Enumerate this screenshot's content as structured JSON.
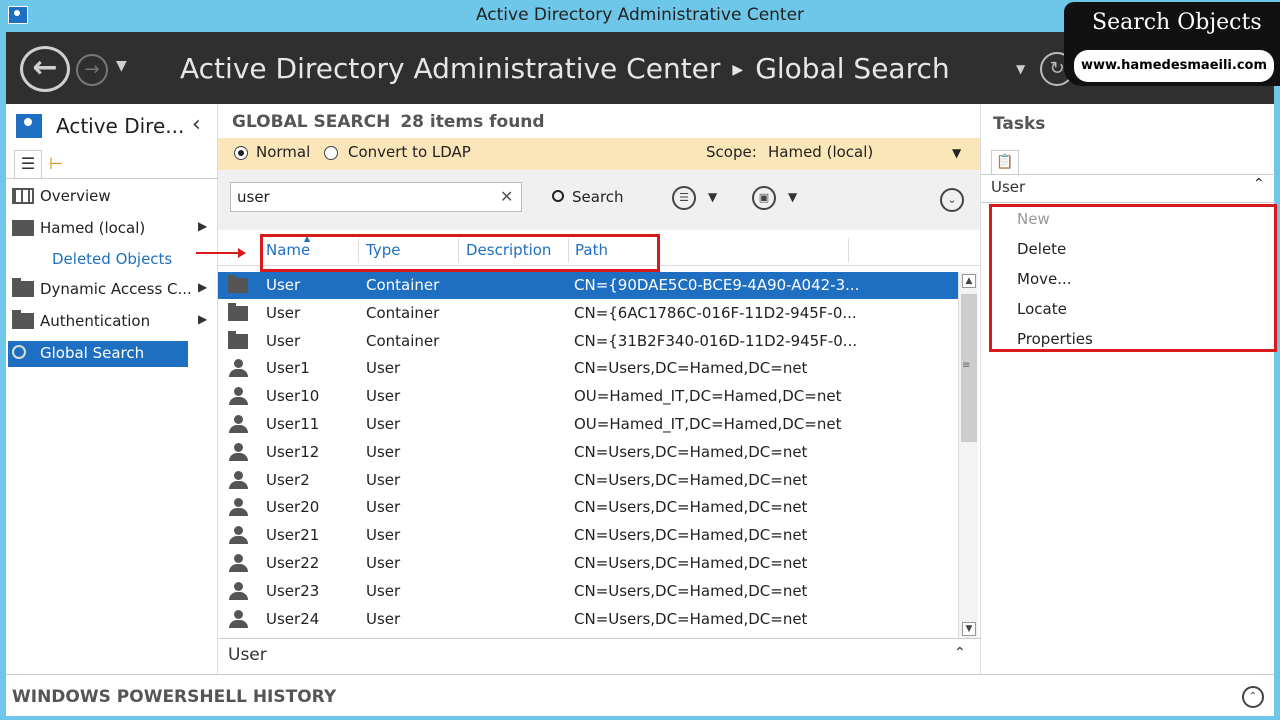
{
  "window": {
    "title": "Active Directory Administrative Center"
  },
  "header": {
    "breadcrumb": [
      "Active Directory Administrative Center",
      "Global Search"
    ],
    "back_icon": "back-arrow-icon",
    "forward_icon": "forward-arrow-icon",
    "refresh_icon": "refresh-icon"
  },
  "watermark": {
    "title": "Search Objects",
    "url": "www.hamedesmaeili.com"
  },
  "leftnav": {
    "title": "Active Dire...",
    "items": [
      {
        "label": "Overview",
        "icon": "overview-icon",
        "has_arrow": false
      },
      {
        "label": "Hamed (local)",
        "icon": "domain-icon",
        "has_arrow": true
      },
      {
        "label": "Dynamic Access C...",
        "icon": "folder-icon",
        "has_arrow": true
      },
      {
        "label": "Authentication",
        "icon": "folder-icon",
        "has_arrow": true
      },
      {
        "label": "Global Search",
        "icon": "search-icon",
        "has_arrow": false,
        "selected": true
      }
    ],
    "sub_item": "Deleted Objects"
  },
  "global_search": {
    "title": "GLOBAL SEARCH",
    "count": "28 items found",
    "mode_normal": "Normal",
    "mode_ldap": "Convert to LDAP",
    "scope_label": "Scope:",
    "scope_value": "Hamed (local)",
    "query": "user",
    "search_label": "Search",
    "columns": [
      "Name",
      "Type",
      "Description",
      "Path"
    ],
    "rows": [
      {
        "name": "User",
        "type": "Container",
        "description": "",
        "path": "CN={90DAE5C0-BCE9-4A90-A042-3...",
        "icon": "folder",
        "selected": true
      },
      {
        "name": "User",
        "type": "Container",
        "description": "",
        "path": "CN={6AC1786C-016F-11D2-945F-0...",
        "icon": "folder"
      },
      {
        "name": "User",
        "type": "Container",
        "description": "",
        "path": "CN={31B2F340-016D-11D2-945F-0...",
        "icon": "folder"
      },
      {
        "name": "User1",
        "type": "User",
        "description": "",
        "path": "CN=Users,DC=Hamed,DC=net",
        "icon": "user"
      },
      {
        "name": "User10",
        "type": "User",
        "description": "",
        "path": "OU=Hamed_IT,DC=Hamed,DC=net",
        "icon": "user"
      },
      {
        "name": "User11",
        "type": "User",
        "description": "",
        "path": "OU=Hamed_IT,DC=Hamed,DC=net",
        "icon": "user"
      },
      {
        "name": "User12",
        "type": "User",
        "description": "",
        "path": "CN=Users,DC=Hamed,DC=net",
        "icon": "user"
      },
      {
        "name": "User2",
        "type": "User",
        "description": "",
        "path": "CN=Users,DC=Hamed,DC=net",
        "icon": "user"
      },
      {
        "name": "User20",
        "type": "User",
        "description": "",
        "path": "CN=Users,DC=Hamed,DC=net",
        "icon": "user"
      },
      {
        "name": "User21",
        "type": "User",
        "description": "",
        "path": "CN=Users,DC=Hamed,DC=net",
        "icon": "user"
      },
      {
        "name": "User22",
        "type": "User",
        "description": "",
        "path": "CN=Users,DC=Hamed,DC=net",
        "icon": "user"
      },
      {
        "name": "User23",
        "type": "User",
        "description": "",
        "path": "CN=Users,DC=Hamed,DC=net",
        "icon": "user"
      },
      {
        "name": "User24",
        "type": "User",
        "description": "",
        "path": "CN=Users,DC=Hamed,DC=net",
        "icon": "user"
      }
    ],
    "detail_label": "User"
  },
  "tasks": {
    "title": "Tasks",
    "section": "User",
    "items": [
      {
        "label": "New",
        "enabled": false
      },
      {
        "label": "Delete",
        "enabled": true
      },
      {
        "label": "Move...",
        "enabled": true
      },
      {
        "label": "Locate",
        "enabled": true
      },
      {
        "label": "Properties",
        "enabled": true
      }
    ]
  },
  "powershell": {
    "label": "WINDOWS POWERSHELL HISTORY"
  },
  "colors": {
    "accent": "#1e6fc1",
    "header_bg": "#2f2f2f",
    "frame": "#6ec6e8",
    "scope_bg": "#fbe6b9",
    "annotation": "#d91a1a"
  }
}
